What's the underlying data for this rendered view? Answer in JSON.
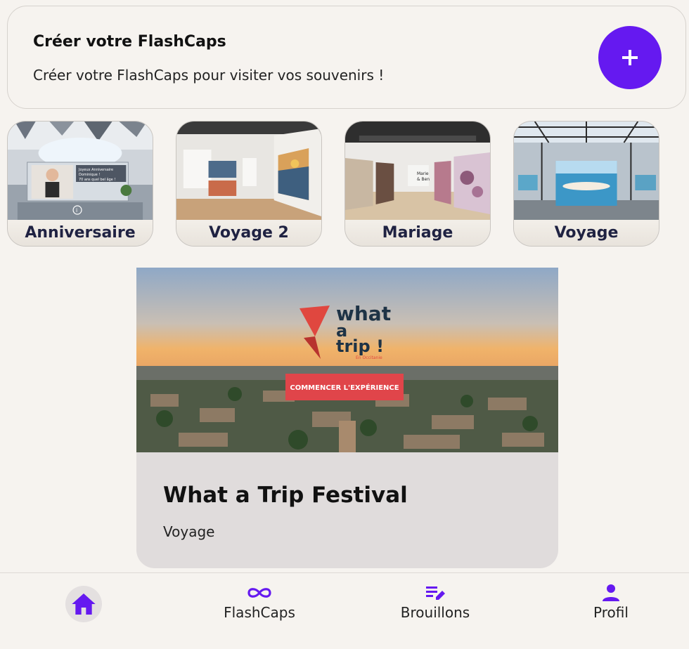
{
  "create": {
    "title": "Créer votre FlashCaps",
    "subtitle": "Créer votre FlashCaps pour visiter vos souvenirs !",
    "add_icon": "plus-icon"
  },
  "chips": [
    {
      "label": "Anniversaire",
      "scene_text": [
        "Joyeux Anniversaire",
        "Dominique !",
        "70 ans quel bel âge !"
      ]
    },
    {
      "label": "Voyage 2"
    },
    {
      "label": "Mariage",
      "scene_text": [
        "Marie",
        "& Ben"
      ]
    },
    {
      "label": "Voyage"
    }
  ],
  "event": {
    "logo": [
      "what",
      "a",
      "trip !"
    ],
    "logo_small": "En Occitanie",
    "cta": "COMMENCER L'EXPÉRIENCE",
    "title": "What a Trip Festival",
    "category": "Voyage"
  },
  "nav": {
    "home_icon": "home-icon",
    "flashcaps_label": "FlashCaps",
    "flashcaps_icon": "infinity-icon",
    "drafts_label": "Brouillons",
    "drafts_icon": "edit-list-icon",
    "profile_label": "Profil",
    "profile_icon": "person-icon",
    "accent": "#6519f0"
  }
}
